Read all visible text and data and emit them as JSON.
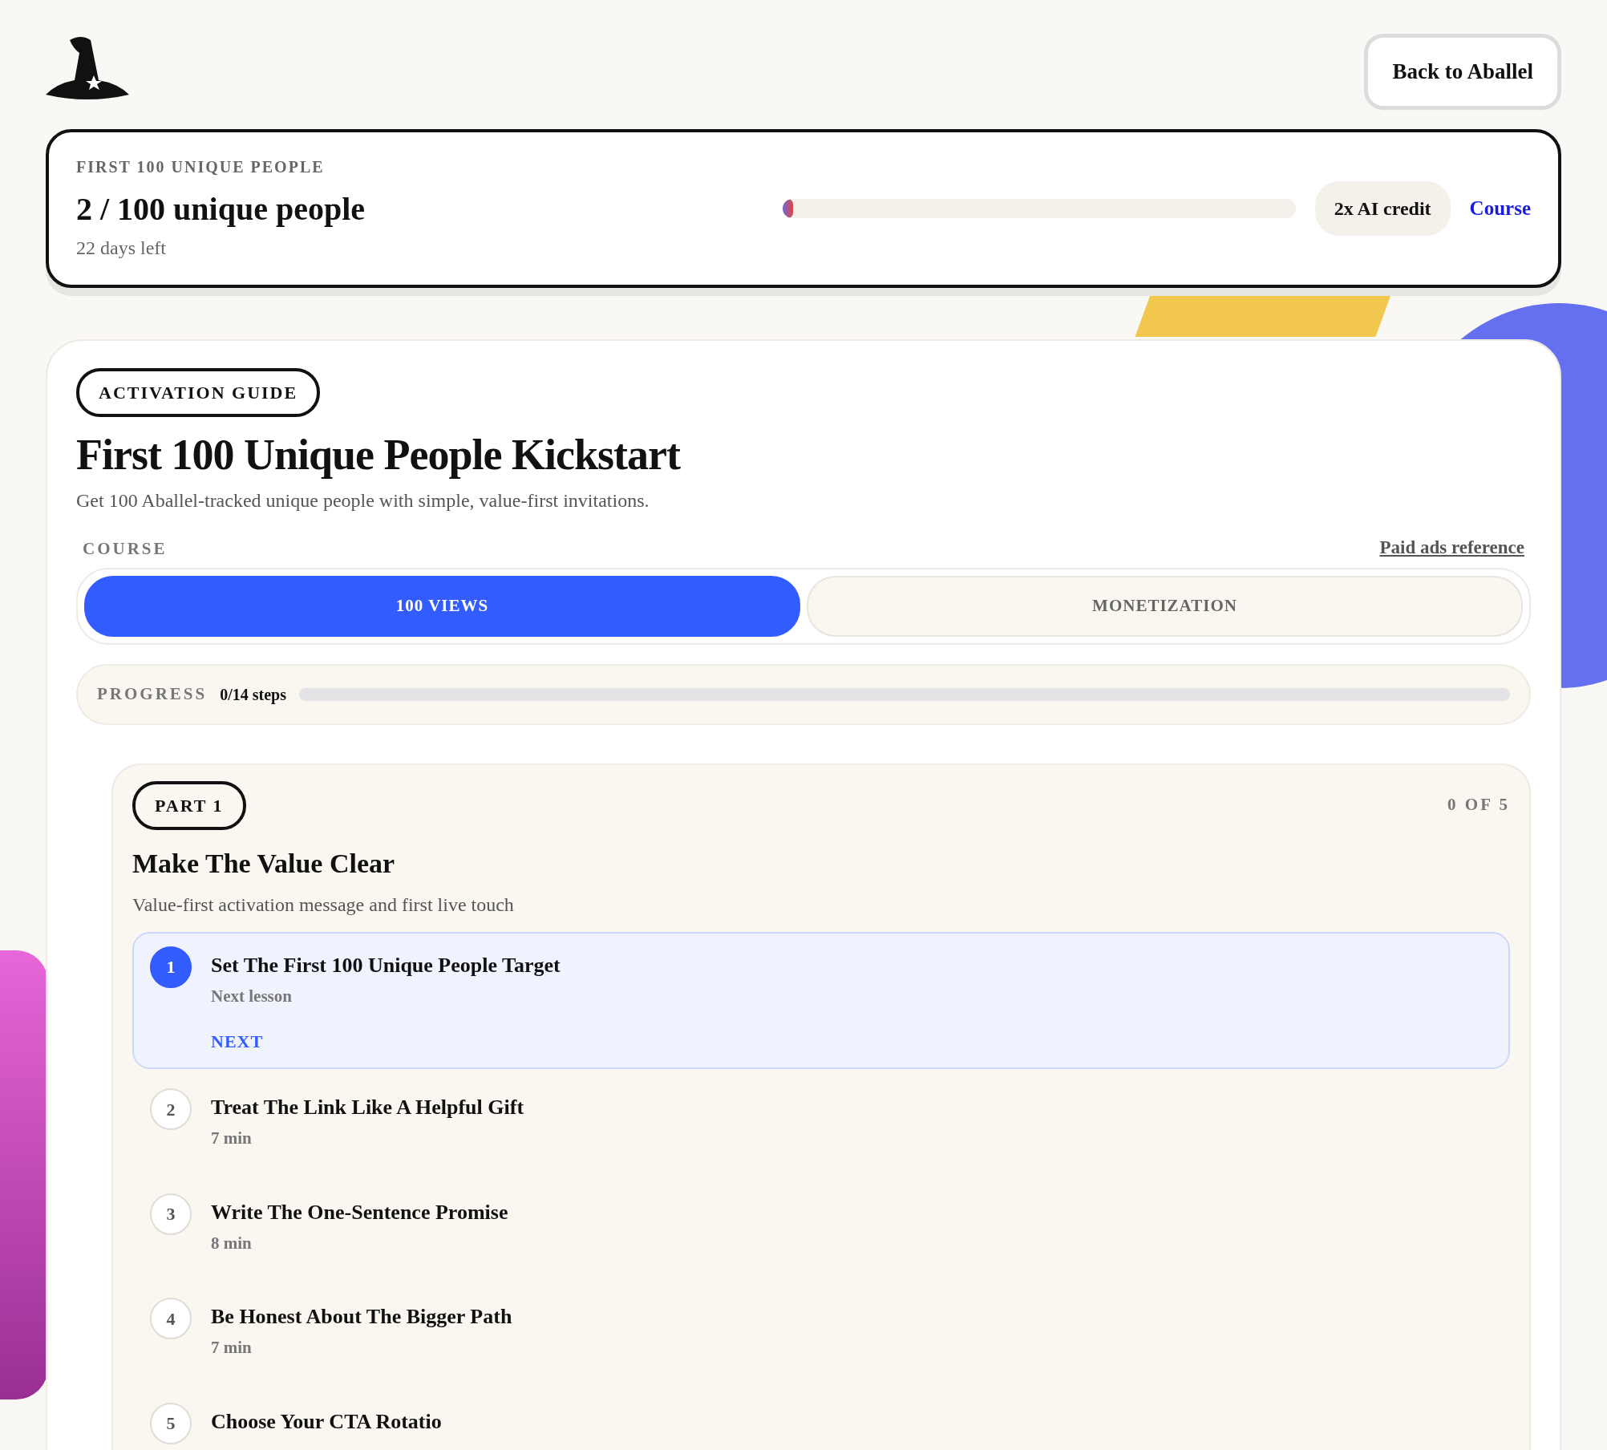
{
  "header": {
    "back_button": "Back to Aballel"
  },
  "goal_card": {
    "eyebrow": "FIRST 100 UNIQUE PEOPLE",
    "count": "2 / 100 unique people",
    "days_left": "22 days left",
    "level": 0.02,
    "reward": "2x AI credit",
    "link": "Course"
  },
  "guide": {
    "badge": "ACTIVATION GUIDE",
    "title": "First 100 Unique People Kickstart",
    "subtitle": "Get 100 Aballel-tracked unique people with simple, value-first invitations.",
    "course_label": "COURSE",
    "reference_link": "Paid ads reference",
    "tabs": [
      {
        "label": "100 VIEWS",
        "selected": true
      },
      {
        "label": "MONETIZATION",
        "selected": false
      }
    ],
    "progress": {
      "label": "PROGRESS",
      "reading": "0/14 steps",
      "level": 0
    }
  },
  "part": {
    "badge": "PART 1",
    "count": "0 OF 5",
    "title": "Make The Value Clear",
    "subtitle": "Value-first activation message and first live touch",
    "lessons": [
      {
        "number": "1",
        "title": "Set The First 100 Unique People Target",
        "meta": "Next lesson",
        "action": "NEXT",
        "current": true
      },
      {
        "number": "2",
        "title": "Treat The Link Like A Helpful Gift",
        "meta": "7 min",
        "current": false
      },
      {
        "number": "3",
        "title": "Write The One-Sentence Promise",
        "meta": "8 min",
        "current": false
      },
      {
        "number": "4",
        "title": "Be Honest About The Bigger Path",
        "meta": "7 min",
        "current": false
      },
      {
        "number": "5",
        "title": "Choose Your CTA Rotatio",
        "current": false
      }
    ]
  }
}
